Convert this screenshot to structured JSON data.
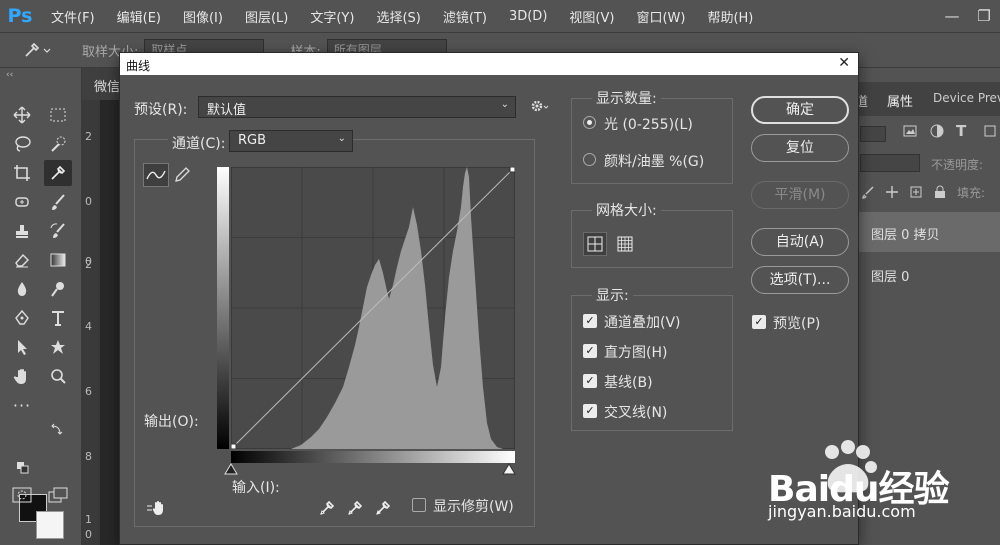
{
  "menubar": {
    "logo": "Ps",
    "items": [
      "文件(F)",
      "编辑(E)",
      "图像(I)",
      "图层(L)",
      "文字(Y)",
      "选择(S)",
      "滤镜(T)",
      "3D(D)",
      "视图(V)",
      "窗口(W)",
      "帮助(H)"
    ]
  },
  "optbar": {
    "sample_size_label": "取样大小:",
    "sample_size_value": "取样点",
    "sample_label": "样本:",
    "sample_value": "所有图层"
  },
  "document": {
    "tab_label": "微信",
    "ruler_marks": [
      "2",
      "0",
      "0",
      "2",
      "4",
      "6",
      "8",
      "1",
      "0"
    ]
  },
  "right_panel": {
    "tabs": [
      "道",
      "属性",
      "Device Preview"
    ],
    "opacity_label": "不透明度:",
    "fill_label": "填充:",
    "layers": [
      "图层 0 拷贝",
      "图层 0"
    ]
  },
  "dialog": {
    "title": "曲线",
    "preset_label": "预设(R):",
    "preset_value": "默认值",
    "channel_label": "通道(C):",
    "channel_value": "RGB",
    "output_label": "输出(O):",
    "input_label": "输入(I):",
    "show_clipping_label": "显示修剪(W)",
    "show_amount": {
      "legend": "显示数量:",
      "light": "光 (0-255)(L)",
      "pigment": "颜料/油墨 %(G)"
    },
    "grid_size": {
      "legend": "网格大小:"
    },
    "show": {
      "legend": "显示:",
      "items": [
        "通道叠加(V)",
        "直方图(H)",
        "基线(B)",
        "交叉线(N)"
      ]
    },
    "buttons": {
      "ok": "确定",
      "reset": "复位",
      "smooth": "平滑(M)",
      "auto": "自动(A)",
      "options": "选项(T)..."
    },
    "preview_label": "预览(P)"
  },
  "watermark": {
    "brand": "Baidu经验",
    "url": "jingyan.baidu.com"
  }
}
